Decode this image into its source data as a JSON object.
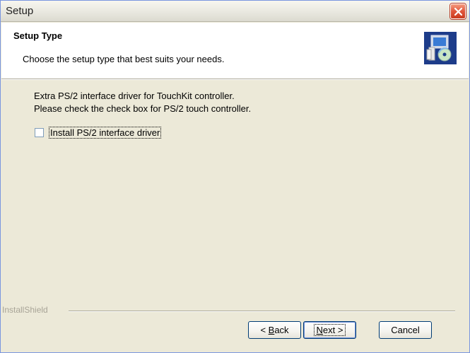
{
  "window": {
    "title": "Setup"
  },
  "header": {
    "title": "Setup Type",
    "subtitle": "Choose the setup type that best suits your needs."
  },
  "body": {
    "line1": "Extra PS/2 interface driver for TouchKit controller.",
    "line2": "Please check the check box for PS/2 touch controller."
  },
  "option": {
    "label": "Install PS/2 interface driver",
    "checked": false
  },
  "branding": {
    "text": "InstallShield"
  },
  "buttons": {
    "back_prefix": "< ",
    "back_mnemonic": "B",
    "back_rest": "ack",
    "next_mnemonic": "N",
    "next_rest": "ext >",
    "cancel": "Cancel"
  },
  "icons": {
    "close": "close-icon",
    "setup": "setup-computer-cd-icon"
  },
  "colors": {
    "dialog_bg": "#ece9d8",
    "close_red": "#e0553a",
    "button_border": "#003c74"
  }
}
